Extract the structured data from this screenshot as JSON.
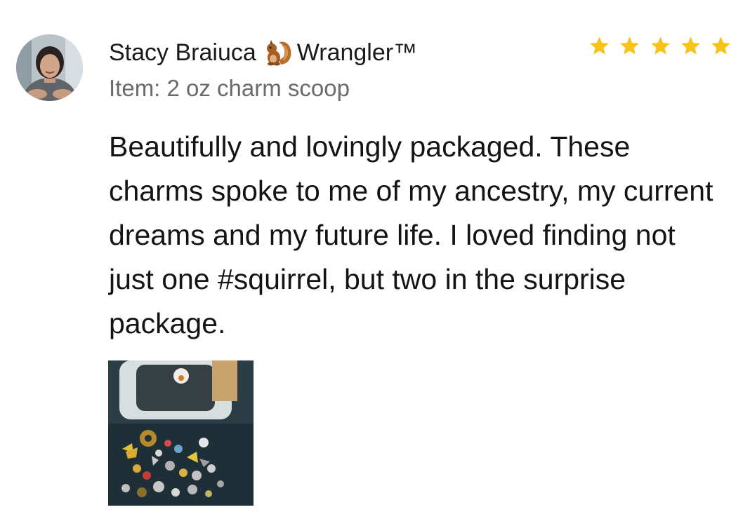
{
  "review": {
    "reviewer_name": "Stacy Braiuca",
    "badge_icon": "squirrel-icon",
    "badge_label": "Wrangler™",
    "item_line": "Item: 2 oz charm scoop",
    "rating": 5,
    "rating_max": 5,
    "star_color": "#f7c21a",
    "text": "Beautifully and lovingly packaged. These charms spoke to me of my ancestry, my current dreams and my future life. I loved finding not just one #squirrel, but two in the surprise package.",
    "photo_icon": "review-photo-thumbnail"
  }
}
